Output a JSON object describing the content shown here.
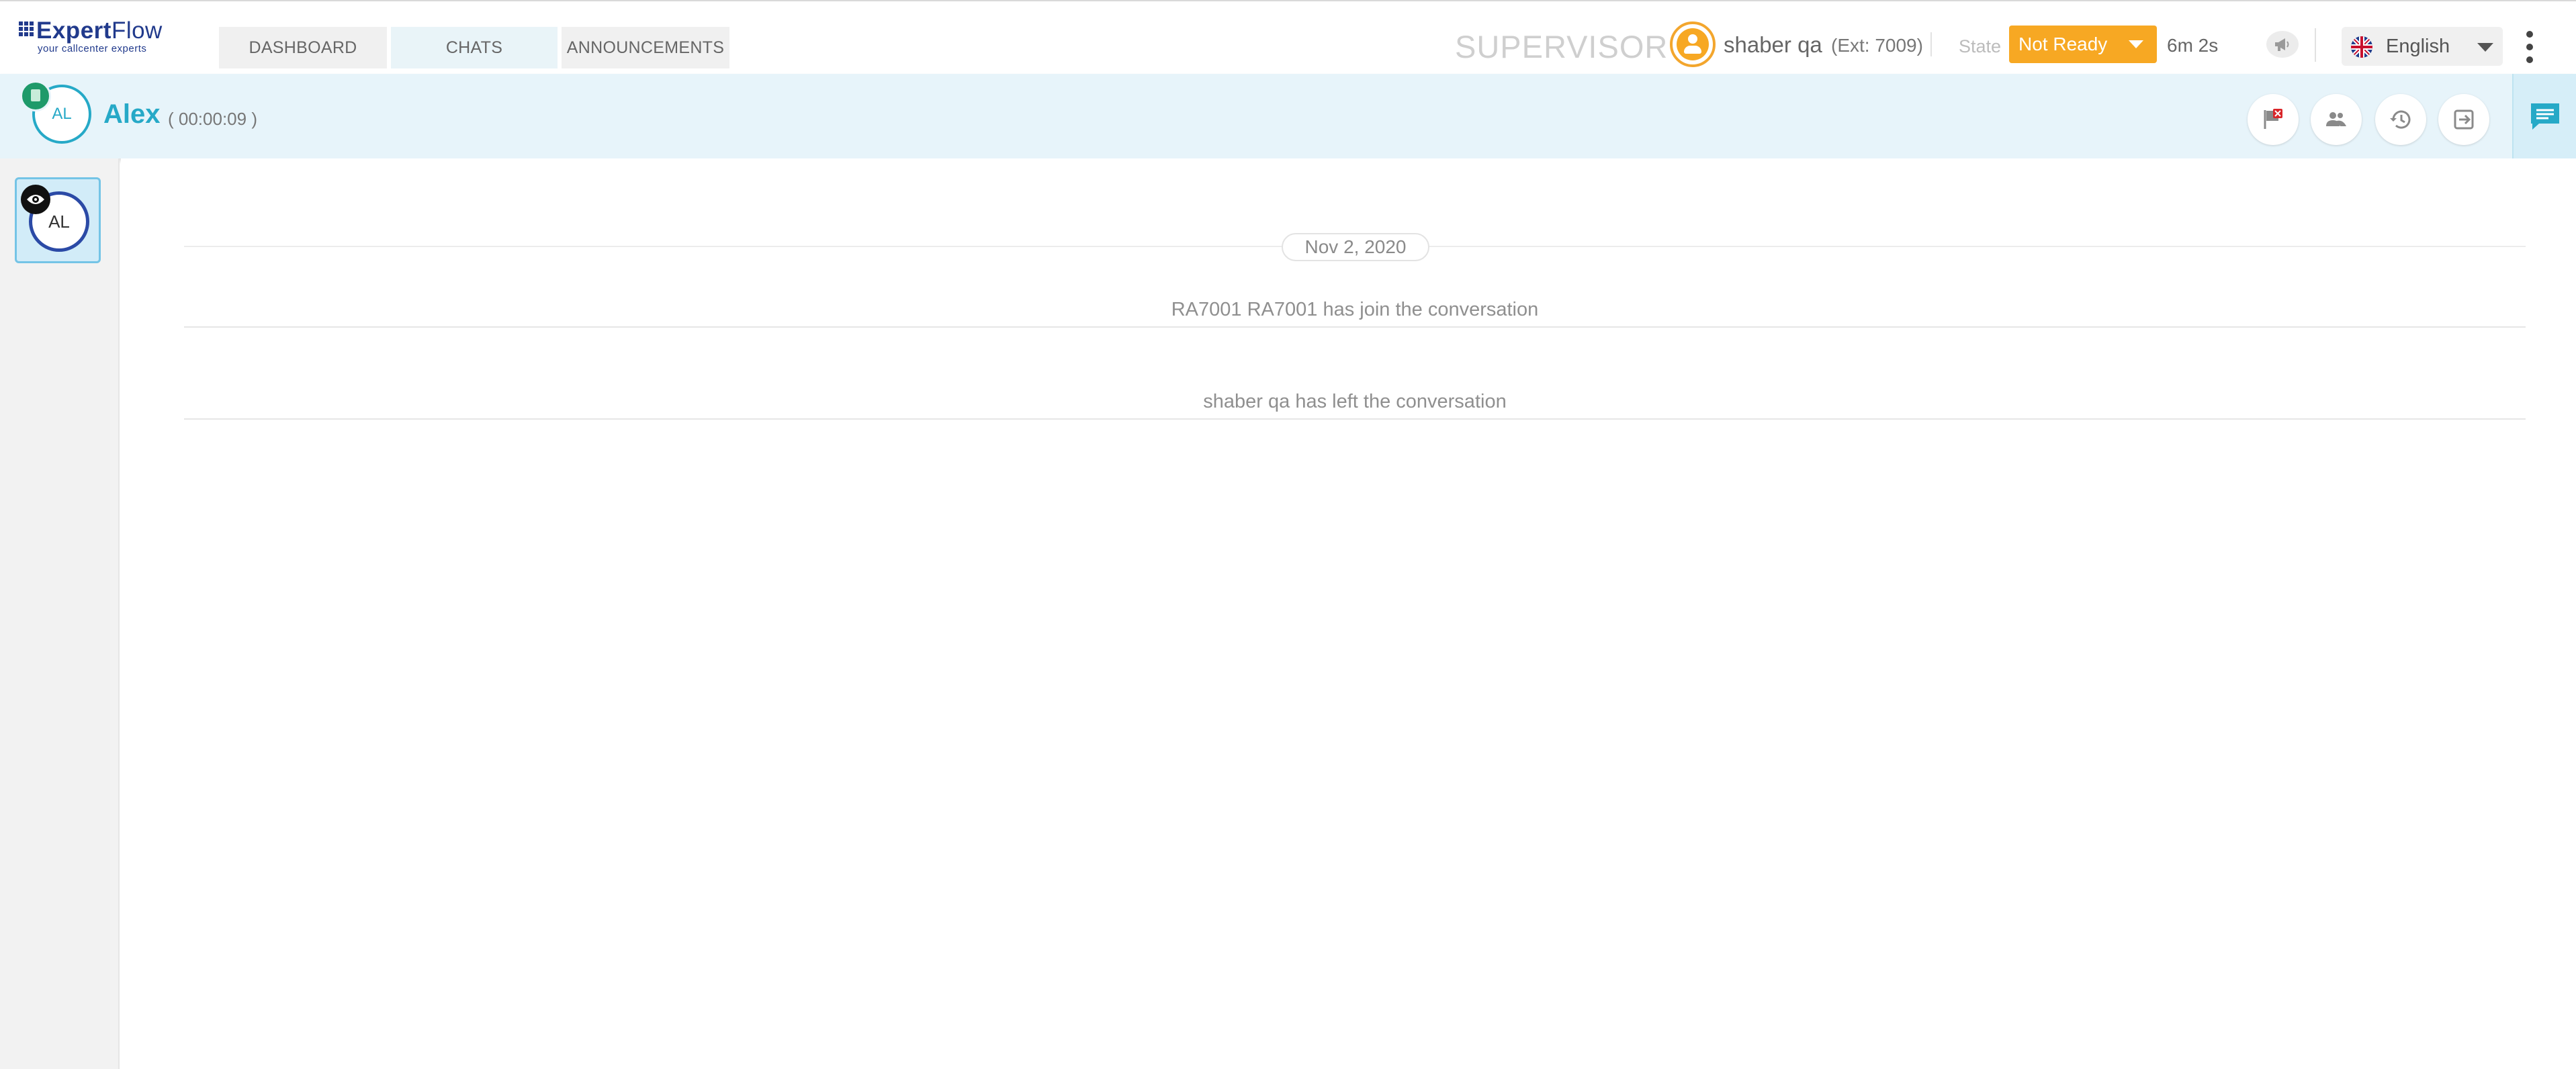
{
  "brand": {
    "name_bold": "Expert",
    "name_regular": "Flow",
    "tagline": "your callcenter experts"
  },
  "nav": {
    "tabs": [
      {
        "label": "DASHBOARD",
        "active": false
      },
      {
        "label": "CHATS",
        "active": true
      },
      {
        "label": "ANNOUNCEMENTS",
        "active": false
      }
    ]
  },
  "header": {
    "role": "SUPERVISOR",
    "username": "shaber qa",
    "extension": "(Ext: 7009)",
    "state_label": "State",
    "state_value": "Not Ready",
    "state_timer": "6m 2s",
    "language": "English"
  },
  "customer": {
    "initials": "AL",
    "name": "Alex",
    "duration": "( 00:00:09 )"
  },
  "sidebar": {
    "sessions": [
      {
        "initials": "AL"
      }
    ]
  },
  "conversation": {
    "date": "Nov 2, 2020",
    "events": [
      "RA7001 RA7001 has join the conversation",
      "shaber qa has left the conversation"
    ]
  },
  "colors": {
    "accent": "#26a9c7",
    "brand": "#213a8c",
    "state_not_ready": "#f7a823",
    "header_bg": "#e7f4fa"
  },
  "icons": {
    "top": [
      "user-avatar-icon",
      "megaphone-icon",
      "uk-flag-icon",
      "kebab-menu-icon",
      "chevron-down-icon"
    ],
    "actions": [
      "flag-icon",
      "participants-icon",
      "history-icon",
      "exit-icon",
      "chat-icon"
    ],
    "session": [
      "eye-icon"
    ]
  }
}
